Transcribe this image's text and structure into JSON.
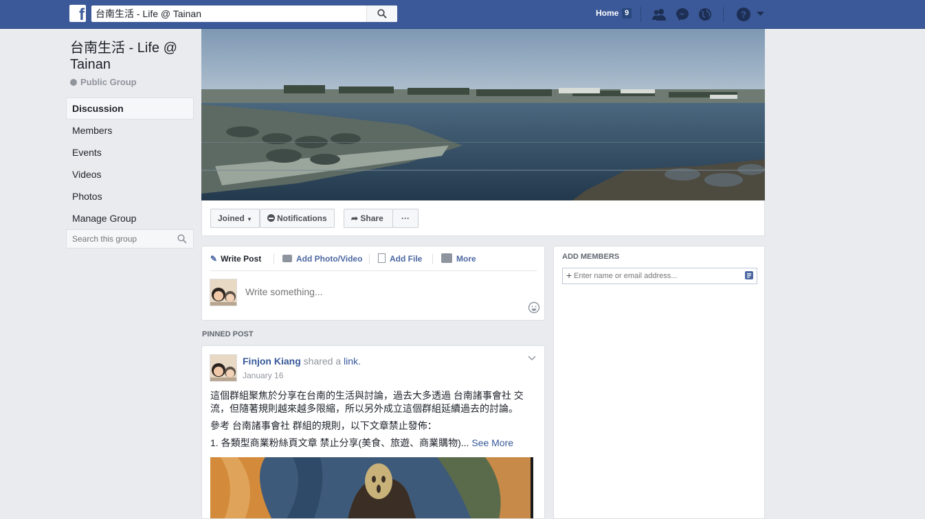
{
  "topbar": {
    "logo_letter": "f",
    "search_value": "台南生活 - Life @ Tainan",
    "home_label": "Home",
    "home_count": "9",
    "icons": [
      "friend-requests-icon",
      "messenger-icon",
      "notifications-globe-icon",
      "help-icon",
      "account-menu-caret-icon"
    ]
  },
  "group": {
    "title": "台南生活 - Life @ Tainan",
    "privacy": "Public Group"
  },
  "sidebar": {
    "items": [
      {
        "label": "Discussion"
      },
      {
        "label": "Members"
      },
      {
        "label": "Events"
      },
      {
        "label": "Videos"
      },
      {
        "label": "Photos"
      },
      {
        "label": "Manage Group"
      }
    ],
    "search_placeholder": "Search this group"
  },
  "actions": {
    "joined": "Joined",
    "notifications": "Notifications",
    "share": "Share",
    "more": "···"
  },
  "composer": {
    "tabs": [
      "Write Post",
      "Add Photo/Video",
      "Add File",
      "More"
    ],
    "placeholder": "Write something..."
  },
  "add_members": {
    "heading": "ADD MEMBERS",
    "placeholder": "Enter name or email address..."
  },
  "pinned_label": "PINNED POST",
  "post": {
    "author": "Finjon Kiang",
    "action": "shared a",
    "link_word": "link.",
    "date": "January 16",
    "paragraph1": "這個群組聚焦於分享在台南的生活與討論，過去大多透過 台南諸事會社 交流，但隨著規則越來越多限縮，所以另外成立這個群組延續過去的討論。",
    "paragraph2": "參考 台南諸事會社 群組的規則，以下文章禁止發佈：",
    "paragraph3": "1. 各類型商業粉絲頁文章 禁止分享(美食、旅遊、商業購物)...",
    "see_more": "See More"
  }
}
